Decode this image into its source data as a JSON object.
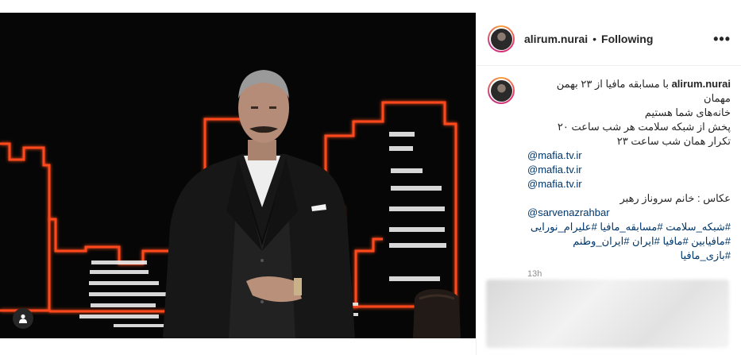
{
  "post": {
    "username": "alirum.nurai",
    "separator": "•",
    "follow_status": "Following",
    "more_label": "•••",
    "caption": {
      "username": "alirum.nurai",
      "line1": "با مسابقه مافیا از ۲۳ بهمن مهمان",
      "line2": "خانه‌های شما هستیم",
      "line3": "پخش از شبکه سلامت هر شب ساعت ۲۰",
      "line4": "تکرار همان شب ساعت ۲۳",
      "mentions": [
        "@mafia.tv.ir",
        "@mafia.tv.ir",
        "@mafia.tv.ir"
      ],
      "credit": "عکاس : خانم سروناز رهبر",
      "credit_mention": "@sarvenazrahbar",
      "hashtags1": "#شبکه_سلامت #مسابقه_مافیا #علیرام_نورایی",
      "hashtags2": "#مافیابین #مافیا #ایران #ایران_وطنم #بازی_مافیا"
    },
    "timestamp": "13h"
  },
  "icons": {
    "tag_people": "person-icon",
    "more": "more-options-icon"
  },
  "colors": {
    "neon_orange": "#ff4a1c",
    "link": "#00376b",
    "text": "#262626",
    "muted": "#8e8e8e"
  }
}
